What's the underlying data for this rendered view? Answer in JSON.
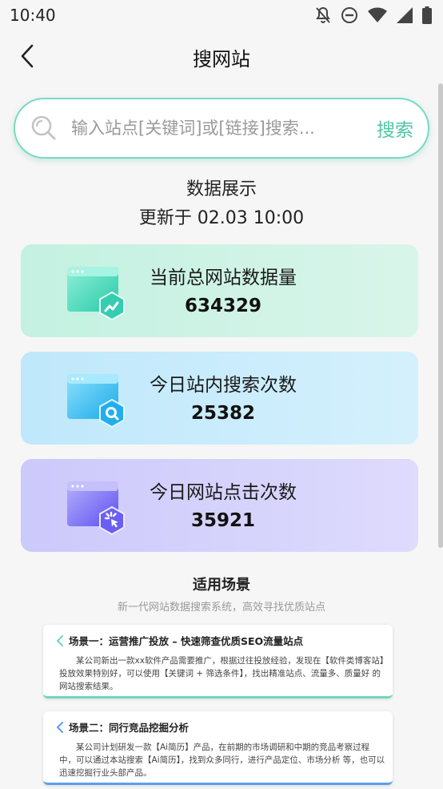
{
  "status_bar": {
    "time": "10:40"
  },
  "header": {
    "title": "搜网站"
  },
  "search": {
    "placeholder": "输入站点[关键词]或[链接]搜索...",
    "button_label": "搜索"
  },
  "data_display": {
    "heading": "数据展示",
    "update_time": "更新于 02.03 10:00"
  },
  "stats": [
    {
      "label": "当前总网站数据量",
      "value": "634329",
      "icon": "trend-chart-icon",
      "color": "#3fd2b4"
    },
    {
      "label": "今日站内搜索次数",
      "value": "25382",
      "icon": "magnify-icon",
      "color": "#2ab8ee"
    },
    {
      "label": "今日网站点击次数",
      "value": "35921",
      "icon": "click-icon",
      "color": "#6f63f2"
    }
  ],
  "scenarios": {
    "heading": "适用场景",
    "subtitle": "新一代网站数据搜索系统，高效寻找优质站点",
    "items": [
      {
        "title": "场景一：运营推广投放 – 快速筛查优质SEO流量站点",
        "body": "某公司新出一款xx软件产品需要推广，根据过往投放经验，发现在【软件类博客站】投放效果特别好，可以使用【关键词 + 筛选条件】，找出精准站点、流量多、质量好 的网站搜索结果。"
      },
      {
        "title": "场景二：同行竞品挖掘分析",
        "body": "某公司计划研发一款【Ai简历】产品，在前期的市场调研和中期的竞品考察过程中，可以通过本站搜索【Ai简历】，找到众多同行，进行产品定位、市场分析 等，也可以迅速挖掘行业头部产品。"
      }
    ]
  }
}
